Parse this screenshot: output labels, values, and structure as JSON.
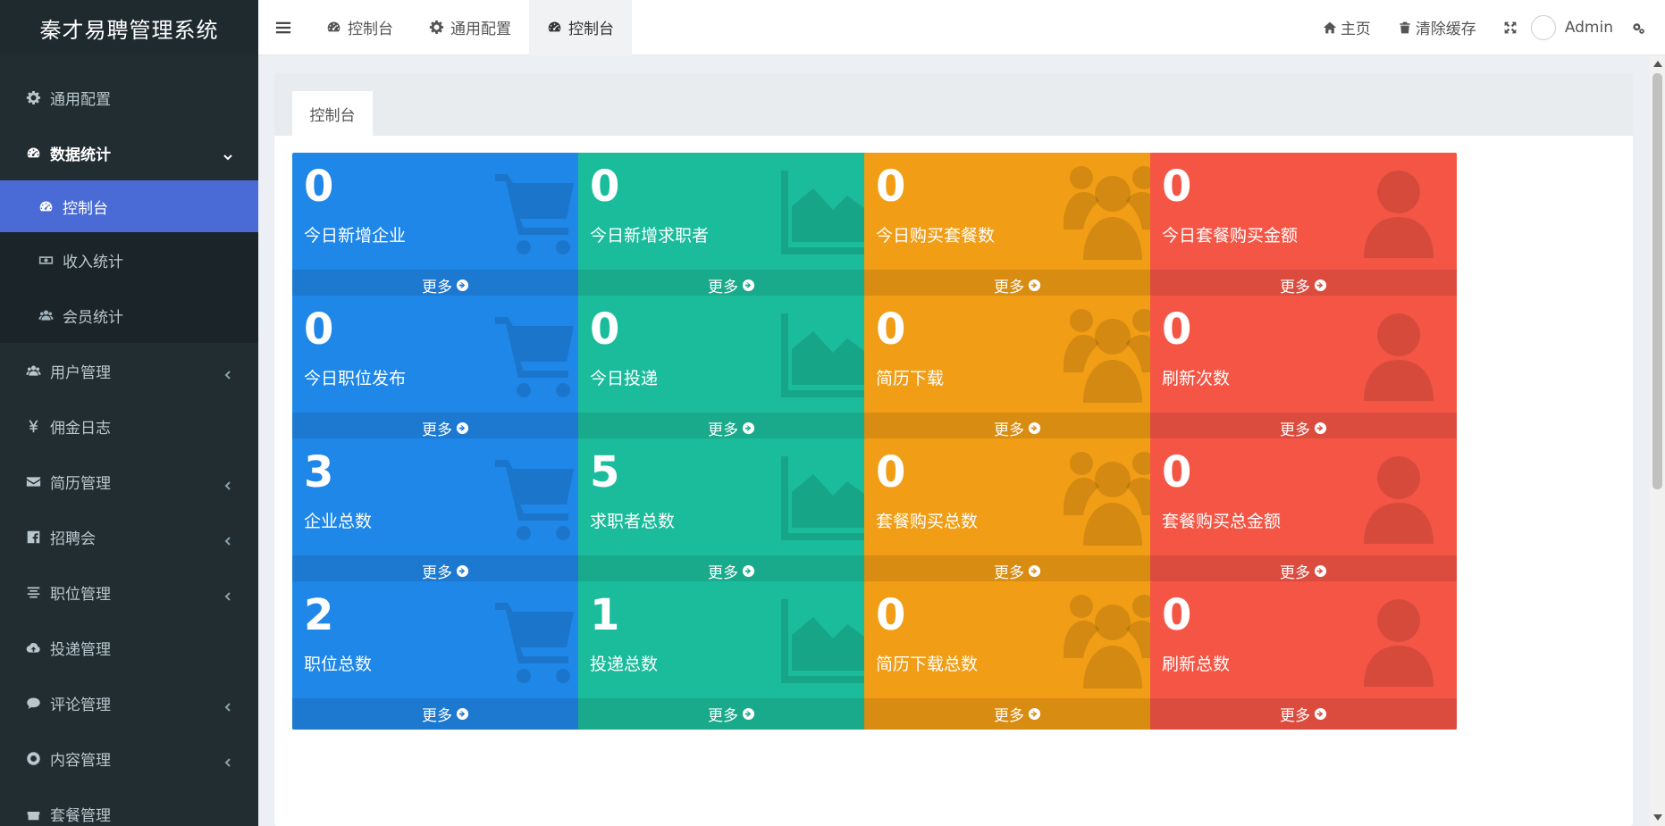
{
  "app": {
    "title": "秦才易聘管理系统"
  },
  "sidebar": {
    "items": [
      {
        "label": "通用配置",
        "icon": "gear-icon"
      },
      {
        "label": "数据统计",
        "icon": "dashboard-icon",
        "open": true
      },
      {
        "label": "控制台",
        "icon": "dashboard-icon",
        "sub": true,
        "active": true
      },
      {
        "label": "收入统计",
        "icon": "money-icon",
        "sub": true
      },
      {
        "label": "会员统计",
        "icon": "users-icon",
        "sub": true
      },
      {
        "label": "用户管理",
        "icon": "users-icon",
        "chevron": true
      },
      {
        "label": "佣金日志",
        "icon": "yen-icon"
      },
      {
        "label": "简历管理",
        "icon": "envelope-icon",
        "chevron": true
      },
      {
        "label": "招聘会",
        "icon": "facebook-square-icon",
        "chevron": true
      },
      {
        "label": "职位管理",
        "icon": "align-center-icon",
        "chevron": true
      },
      {
        "label": "投递管理",
        "icon": "cloud-upload-icon"
      },
      {
        "label": "评论管理",
        "icon": "comment-icon",
        "chevron": true
      },
      {
        "label": "内容管理",
        "icon": "life-ring-icon",
        "chevron": true
      },
      {
        "label": "套餐管理",
        "icon": "gift-icon"
      }
    ]
  },
  "header": {
    "tabs": [
      {
        "label": "控制台",
        "icon": "dashboard-icon"
      },
      {
        "label": "通用配置",
        "icon": "gear-icon"
      },
      {
        "label": "控制台",
        "icon": "dashboard-icon",
        "active": true
      }
    ],
    "home_label": "主页",
    "clear_cache_label": "清除缓存",
    "user_name": "Admin"
  },
  "content": {
    "tab_label": "控制台",
    "more_label": "更多",
    "cards": [
      {
        "value": "0",
        "label": "今日新增企业",
        "color": "blue"
      },
      {
        "value": "0",
        "label": "今日新增求职者",
        "color": "green"
      },
      {
        "value": "0",
        "label": "今日购买套餐数",
        "color": "orange"
      },
      {
        "value": "0",
        "label": "今日套餐购买金额",
        "color": "red"
      },
      {
        "value": "0",
        "label": "今日职位发布",
        "color": "blue"
      },
      {
        "value": "0",
        "label": "今日投递",
        "color": "green"
      },
      {
        "value": "0",
        "label": "简历下载",
        "color": "orange"
      },
      {
        "value": "0",
        "label": "刷新次数",
        "color": "red"
      },
      {
        "value": "3",
        "label": "企业总数",
        "color": "blue"
      },
      {
        "value": "5",
        "label": "求职者总数",
        "color": "green"
      },
      {
        "value": "0",
        "label": "套餐购买总数",
        "color": "orange"
      },
      {
        "value": "0",
        "label": "套餐购买总金额",
        "color": "red"
      },
      {
        "value": "2",
        "label": "职位总数",
        "color": "blue"
      },
      {
        "value": "1",
        "label": "投递总数",
        "color": "green"
      },
      {
        "value": "0",
        "label": "简历下载总数",
        "color": "orange"
      },
      {
        "value": "0",
        "label": "刷新总数",
        "color": "red"
      }
    ]
  },
  "colors": {
    "blue": "#1f87e8",
    "green": "#1bbc9b",
    "orange": "#f19d15",
    "red": "#f45545",
    "sidebar": "#222d32",
    "active_menu": "#4a6ad6"
  }
}
